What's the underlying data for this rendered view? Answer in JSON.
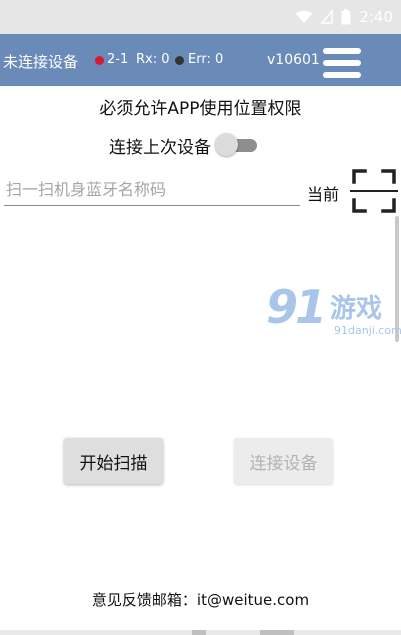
{
  "status_bar": {
    "time": "2:40",
    "icons": [
      "wifi-icon",
      "signal-icon",
      "battery-icon"
    ]
  },
  "app_bar": {
    "connection_state": "未连接设备",
    "channel": "2-1",
    "rx": "Rx: 0",
    "err": "Err: 0",
    "version": "v10601",
    "menu_icon": "hamburger-menu-icon",
    "colors": {
      "background": "#6a8bb8",
      "rx_dot": "#d71a2d",
      "err_dot": "#333333"
    }
  },
  "main": {
    "location_notice": "必须允许APP使用位置权限",
    "reconnect_label": "连接上次设备",
    "reconnect_on": false,
    "scan_input": {
      "value": "",
      "placeholder": "扫一扫机身蓝牙名称码"
    },
    "current_label": "当前",
    "scan_icon": "qr-scan-icon"
  },
  "watermark": {
    "mark": "91",
    "brand": "游戏",
    "url": "91danji.com"
  },
  "actions": {
    "start_scan": "开始扫描",
    "connect_device": "连接设备",
    "connect_enabled": false
  },
  "footer": {
    "feedback": "意见反馈邮箱：it@weitue.com"
  }
}
